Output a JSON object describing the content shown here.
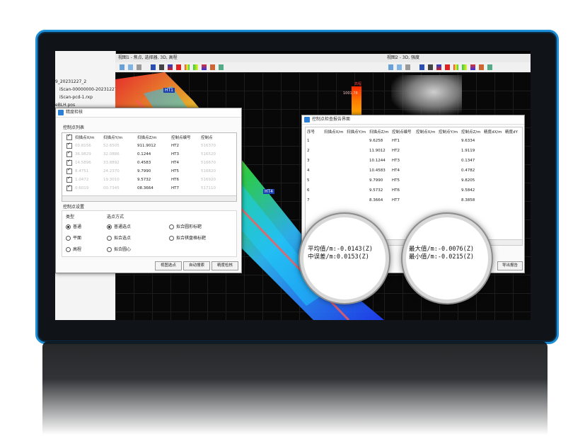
{
  "file_panel": {
    "items": [
      "9_20231227_2",
      "iScan-00000000-20231227",
      "iScan-pcd-1.rxp",
      "eBLH.pos"
    ]
  },
  "view1": {
    "title": "视图1 - 焦点, 选择器, 3D, 高程"
  },
  "view2": {
    "title": "视图2 - 3D, 强度"
  },
  "elevation_label": "高程",
  "elevation_value": "1001.78",
  "point_tags": [
    "HT1",
    "HT4"
  ],
  "accuracy_dialog": {
    "title": "精度检核",
    "list_label": "控制点列表",
    "columns": [
      "扫描点X/m",
      "扫描点Y/m",
      "扫描点Z/m",
      "控制点编号",
      "控制点"
    ],
    "rows": [
      {
        "x": "00.8156",
        "y": "52.6505",
        "z": "911.9012",
        "id": "HT2",
        "c": "516370"
      },
      {
        "x": "36.9829",
        "y": "32.0886",
        "z": "0.1244",
        "id": "HT3",
        "c": "516520"
      },
      {
        "x": "14.5896",
        "y": "33.8892",
        "z": "0.4583",
        "id": "HT4",
        "c": "516670"
      },
      {
        "x": "8.4751",
        "y": "24.2370",
        "z": "9.7990",
        "id": "HT5",
        "c": "516820"
      },
      {
        "x": "1.0472",
        "y": "19.3010",
        "z": "9.5732",
        "id": "HT6",
        "c": "516920"
      },
      {
        "x": "0.6019",
        "y": "00.7345",
        "z": "08.3664",
        "id": "HT7",
        "c": "517110"
      }
    ],
    "settings_label": "控制点设置",
    "type_label": "类型",
    "type_options": [
      "普通",
      "平面",
      "高程"
    ],
    "mode_label": "选点方式",
    "mode_options": [
      "普通选点",
      "拟合选点",
      "拟合圆心",
      "拟合圆形标靶",
      "拟合棋盘格标靶"
    ],
    "buttons": [
      "视图选点",
      "自动搜索",
      "精度检核"
    ]
  },
  "report_dialog": {
    "title": "控制点检查报告界面",
    "columns": [
      "序号",
      "扫描点X/m",
      "扫描点Y/m",
      "扫描点Z/m",
      "控制点编号",
      "控制点X/m",
      "控制点Y/m",
      "控制点Z/m",
      "精度dX/m",
      "精度dY"
    ],
    "rows": [
      {
        "n": "1",
        "z": "9.6258",
        "id": "HT1",
        "cz": "9.6334"
      },
      {
        "n": "2",
        "z": "11.9012",
        "id": "HT2",
        "cz": "1.9119"
      },
      {
        "n": "3",
        "z": "10.1244",
        "id": "HT3",
        "cz": "0.1347"
      },
      {
        "n": "4",
        "z": "10.4583",
        "id": "HT4",
        "cz": "0.4782"
      },
      {
        "n": "5",
        "z": "9.7990",
        "id": "HT5",
        "cz": "9.8205"
      },
      {
        "n": "6",
        "z": "9.5732",
        "id": "HT6",
        "cz": "9.5842"
      },
      {
        "n": "7",
        "z": "8.3664",
        "id": "HT7",
        "cz": "8.3858"
      }
    ],
    "export_button": "导出报告"
  },
  "magnifier_left": {
    "line1": "平均值/m:-0.0143(Z)",
    "line2": "中误差/m:0.0153(Z)"
  },
  "magnifier_right": {
    "line1": "最大值/m:-0.0076(Z)",
    "line2": "最小值/m:-0.0215(Z)"
  },
  "colors": {
    "frame_accent": "#1c8fd8",
    "bezel": "#101418",
    "dialog_icon": "#2b7fd4"
  }
}
